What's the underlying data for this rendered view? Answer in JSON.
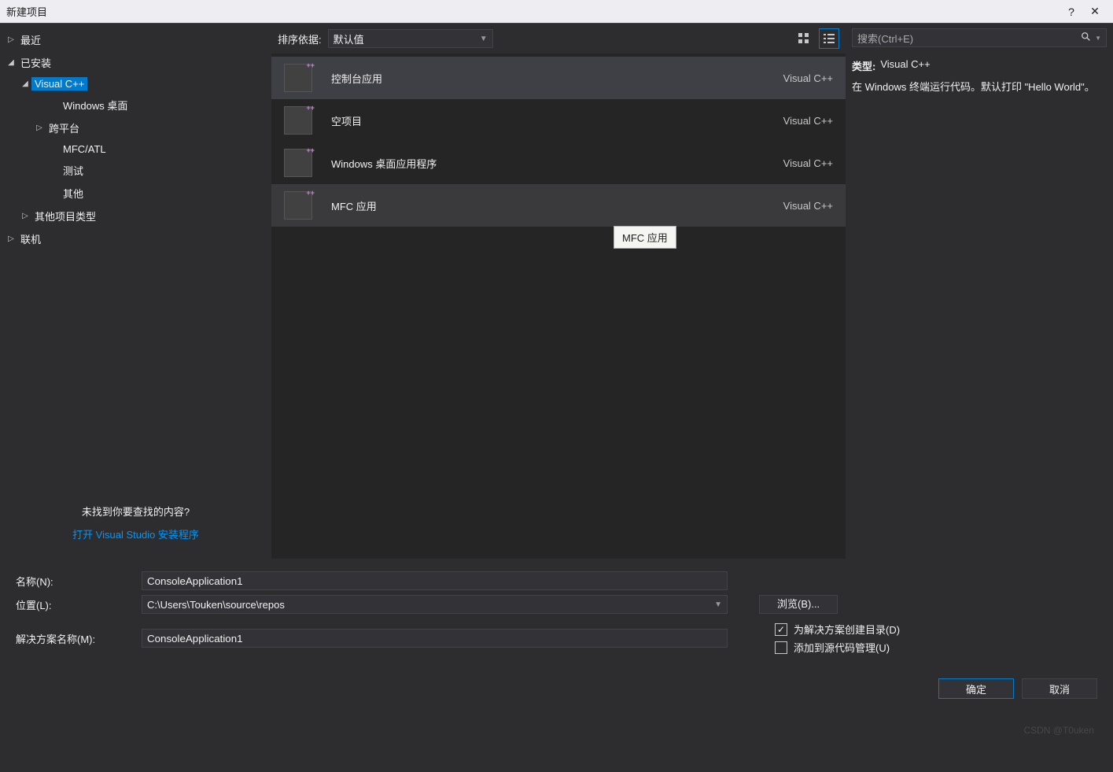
{
  "title": "新建项目",
  "tree": {
    "recent": "最近",
    "installed": "已安装",
    "visualcpp": "Visual C++",
    "winDesktop": "Windows 桌面",
    "crossplat": "跨平台",
    "mfcatl": "MFC/ATL",
    "test": "测试",
    "other": "其他",
    "otherProjTypes": "其他项目类型",
    "online": "联机"
  },
  "sidebarFooter": {
    "notfound": "未找到你要查找的内容?",
    "installerLink": "打开 Visual Studio 安装程序"
  },
  "toolbar": {
    "sortLabel": "排序依据:",
    "sortValue": "默认值"
  },
  "templates": [
    {
      "name": "控制台应用",
      "lang": "Visual C++",
      "state": "selected"
    },
    {
      "name": "空项目",
      "lang": "Visual C++",
      "state": ""
    },
    {
      "name": "Windows 桌面应用程序",
      "lang": "Visual C++",
      "state": ""
    },
    {
      "name": "MFC 应用",
      "lang": "Visual C++",
      "state": "hover"
    }
  ],
  "tooltip": "MFC 应用",
  "search": {
    "placeholder": "搜索(Ctrl+E)"
  },
  "detail": {
    "typeLabel": "类型:",
    "typeValue": "Visual C++",
    "description": "在 Windows 终端运行代码。默认打印 \"Hello World\"。"
  },
  "form": {
    "nameLabel": "名称(N):",
    "nameValue": "ConsoleApplication1",
    "locLabel": "位置(L):",
    "locValue": "C:\\Users\\Touken\\source\\repos",
    "browseLabel": "浏览(B)...",
    "solLabel": "解决方案名称(M):",
    "solValue": "ConsoleApplication1",
    "createDirLabel": "为解决方案创建目录(D)",
    "addSccLabel": "添加到源代码管理(U)"
  },
  "buttons": {
    "ok": "确定",
    "cancel": "取消"
  },
  "watermark": "CSDN @T0uken"
}
